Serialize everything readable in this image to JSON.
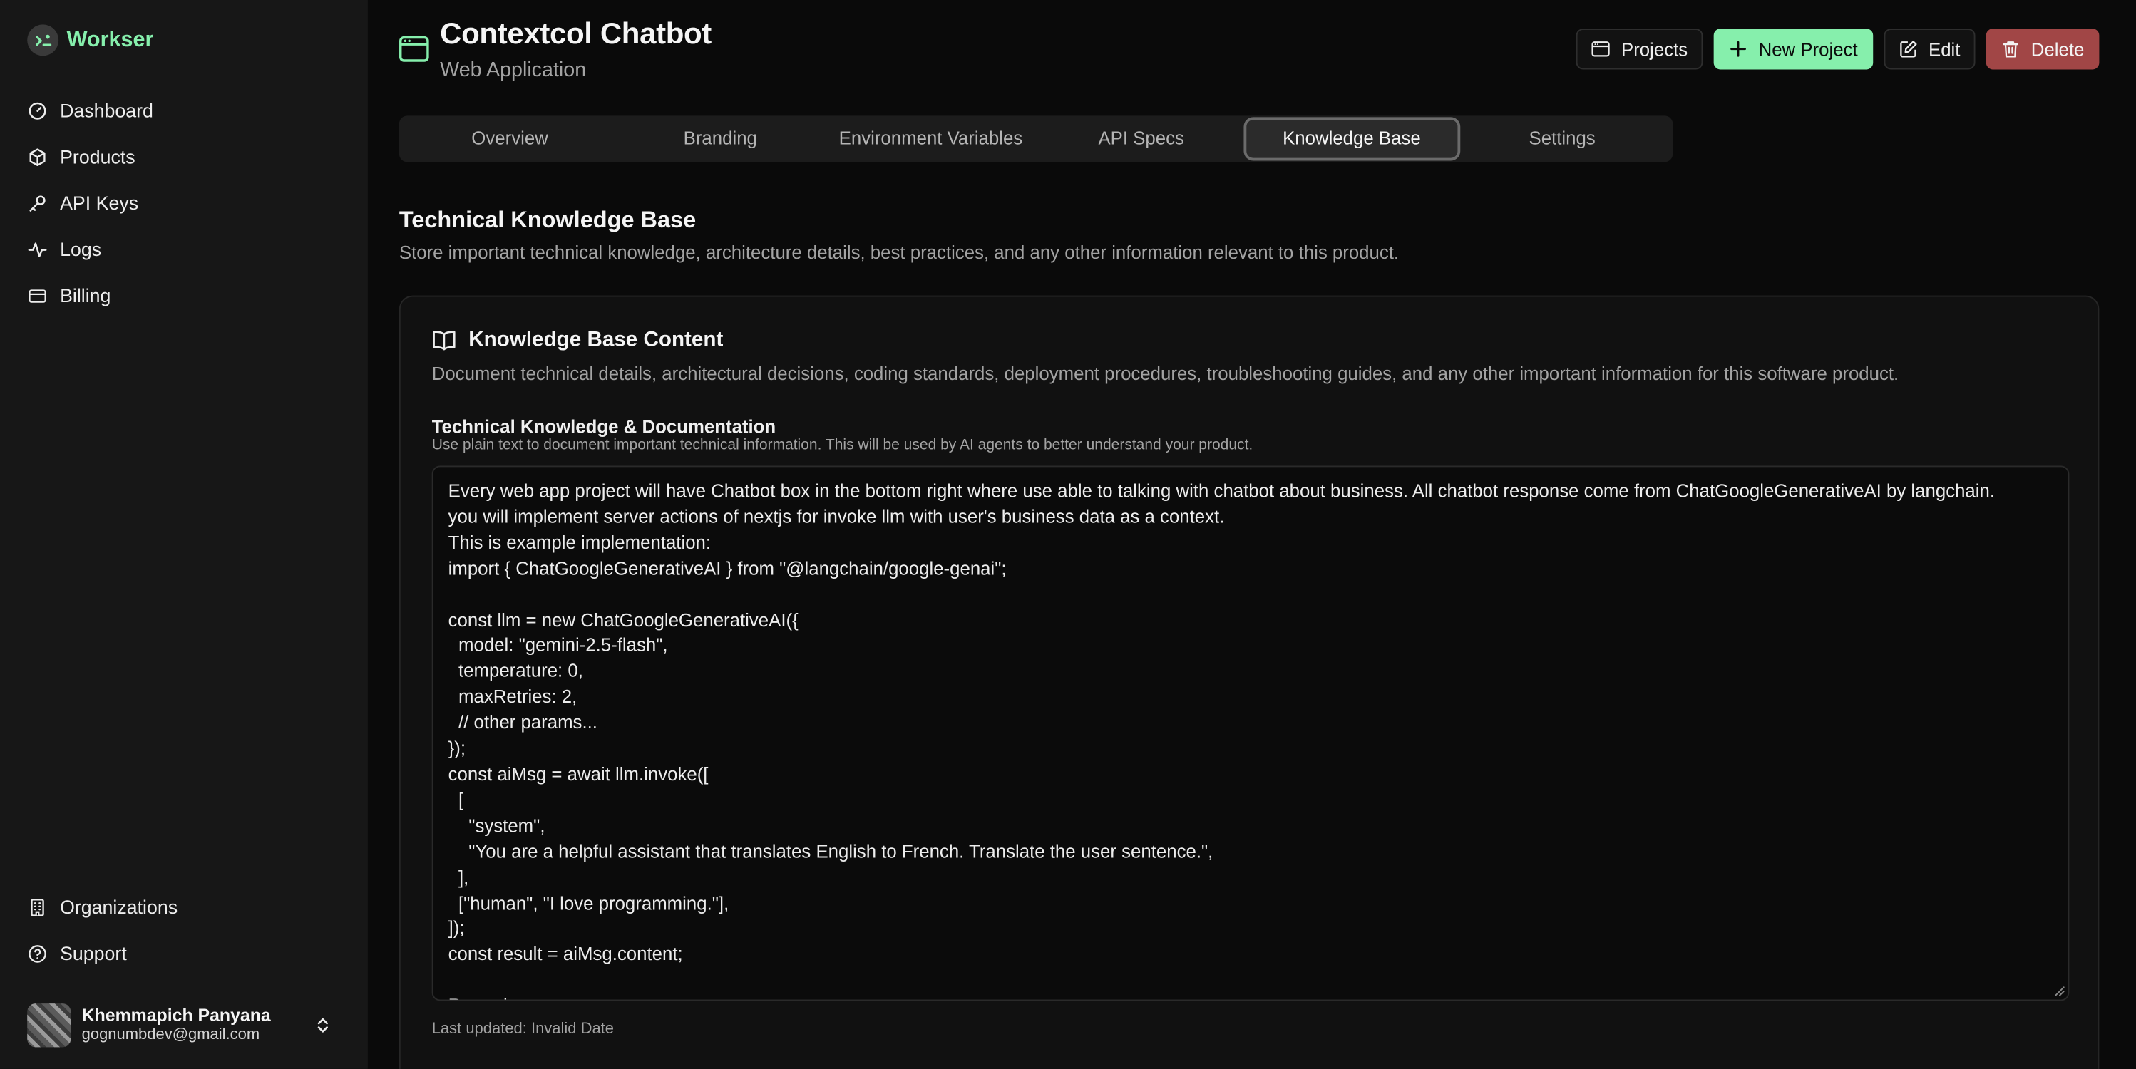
{
  "sidebar": {
    "brand": "Workser",
    "nav": [
      {
        "label": "Dashboard",
        "icon": "gauge-icon"
      },
      {
        "label": "Products",
        "icon": "box-icon"
      },
      {
        "label": "API Keys",
        "icon": "key-icon"
      },
      {
        "label": "Logs",
        "icon": "activity-icon"
      },
      {
        "label": "Billing",
        "icon": "credit-card-icon"
      }
    ],
    "bottom_nav": [
      {
        "label": "Organizations",
        "icon": "building-icon"
      },
      {
        "label": "Support",
        "icon": "help-circle-icon"
      }
    ],
    "user": {
      "name": "Khemmapich Panyana",
      "email": "gognumbdev@gmail.com"
    }
  },
  "header": {
    "title": "Contextcol Chatbot",
    "subtitle": "Web Application",
    "actions": {
      "projects": "Projects",
      "new_project": "New Project",
      "edit": "Edit",
      "delete": "Delete"
    }
  },
  "tabs": [
    {
      "label": "Overview",
      "active": false
    },
    {
      "label": "Branding",
      "active": false
    },
    {
      "label": "Environment Variables",
      "active": false
    },
    {
      "label": "API Specs",
      "active": false
    },
    {
      "label": "Knowledge Base",
      "active": true
    },
    {
      "label": "Settings",
      "active": false
    }
  ],
  "section": {
    "title": "Technical Knowledge Base",
    "description": "Store important technical knowledge, architecture details, best practices, and any other information relevant to this product."
  },
  "card": {
    "title": "Knowledge Base Content",
    "description": "Document technical details, architectural decisions, coding standards, deployment procedures, troubleshooting guides, and any other important information for this software product.",
    "field_label": "Technical Knowledge & Documentation",
    "field_help": "Use plain text to document important technical information. This will be used by AI agents to better understand your product.",
    "content": "Every web app project will have Chatbot box in the bottom right where use able to talking with chatbot about business. All chatbot response come from ChatGoogleGenerativeAI by langchain.\nyou will implement server actions of nextjs for invoke llm with user's business data as a context.\nThis is example implementation:\nimport { ChatGoogleGenerativeAI } from \"@langchain/google-genai\";\n\nconst llm = new ChatGoogleGenerativeAI({\n  model: \"gemini-2.5-flash\",\n  temperature: 0,\n  maxRetries: 2,\n  // other params...\n});\nconst aiMsg = await llm.invoke([\n  [\n    \"system\",\n    \"You are a helpful assistant that translates English to French. Translate the user sentence.\",\n  ],\n  [\"human\", \"I love programming.\"],\n]);\nconst result = aiMsg.content;\n\nRemark:",
    "last_updated": "Last updated: Invalid Date"
  },
  "colors": {
    "accent": "#86efac",
    "danger": "#a14646",
    "background": "#0a0a0a",
    "sidebar": "#171717"
  }
}
